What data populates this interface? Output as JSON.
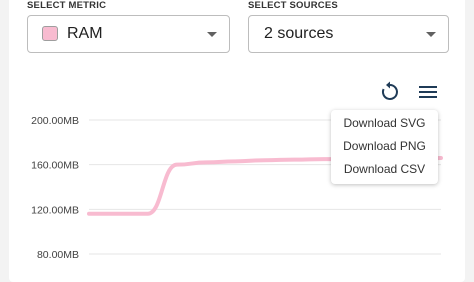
{
  "metric": {
    "label": "SELECT METRIC",
    "selected": "RAM",
    "color": "#f8bbd0"
  },
  "sources": {
    "label": "SELECT SOURCES",
    "selected": "2 sources"
  },
  "toolbar": {
    "reset_icon": "reset-icon",
    "menu_icon": "hamburger-menu-icon"
  },
  "export_menu": {
    "items": [
      "Download SVG",
      "Download PNG",
      "Download CSV"
    ]
  },
  "chart_data": {
    "type": "line",
    "title": "",
    "xlabel": "",
    "ylabel": "",
    "ylim": [
      80,
      200
    ],
    "y_ticks": [
      "200.00MB",
      "160.00MB",
      "120.00MB",
      "80.00MB"
    ],
    "y_tick_values": [
      200,
      160,
      120,
      80
    ],
    "grid": true,
    "series": [
      {
        "color": "#f8bbd0",
        "x": [
          0,
          1,
          2,
          3,
          4,
          5,
          6,
          7,
          8,
          9,
          10,
          11,
          12
        ],
        "y": [
          116,
          116,
          116,
          160,
          162,
          163,
          164,
          164.5,
          165,
          165,
          165,
          165.5,
          166
        ]
      }
    ]
  }
}
